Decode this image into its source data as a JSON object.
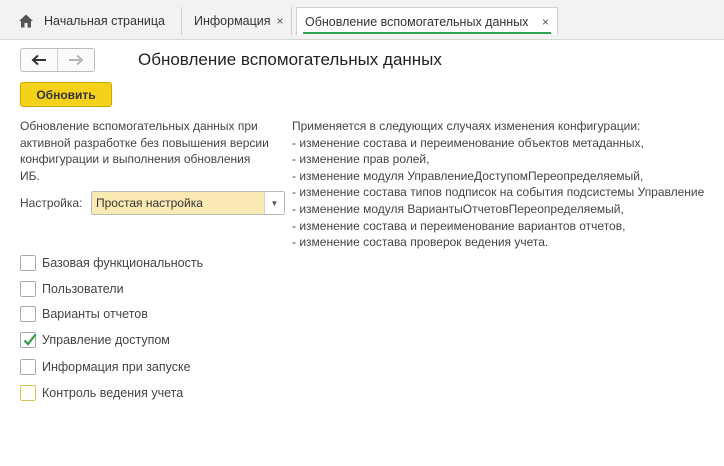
{
  "tabs": {
    "home": {
      "label": "Начальная страница"
    },
    "info": {
      "label": "Информация",
      "close": "×"
    },
    "active": {
      "label": "Обновление вспомогательных данных",
      "close": "×"
    }
  },
  "nav": {
    "back_icon": "arrow-left-icon",
    "forward_icon": "arrow-right-icon",
    "back": "🡐",
    "forward": "🡒"
  },
  "page": {
    "title": "Обновление вспомогательных данных"
  },
  "toolbar": {
    "update_label": "Обновить"
  },
  "description": {
    "left": "Обновление вспомогательных данных при активной разработке без повышения версии конфигурации и выполнения обновления ИБ.",
    "right": [
      "Применяется в следующих случаях изменения конфигурации:",
      "- изменение состава и переименование объектов метаданных,",
      "- изменение прав ролей,",
      "- изменение модуля УправлениеДоступомПереопределяемый,",
      "- изменение состава типов подписок на события подсистемы Управление",
      "- изменение модуля ВариантыОтчетовПереопределяемый,",
      "- изменение состава и переименование вариантов отчетов,",
      "- изменение состава проверок ведения учета."
    ]
  },
  "setting": {
    "label": "Настройка:",
    "value": "Простая настройка",
    "arrow": "▼"
  },
  "checkboxes": [
    {
      "label": "Базовая функциональность",
      "checked": false
    },
    {
      "label": "Пользователи",
      "checked": false
    },
    {
      "label": "Варианты отчетов",
      "checked": false
    },
    {
      "label": "Управление доступом",
      "checked": true
    },
    {
      "label": "Информация при запуске",
      "checked": false
    },
    {
      "label": "Контроль ведения учета",
      "checked": false
    }
  ],
  "colors": {
    "accent": "#f5d21a",
    "tab_underline": "#2ea44f",
    "check": "#2e9e47",
    "select_bg": "#fbeab4"
  }
}
